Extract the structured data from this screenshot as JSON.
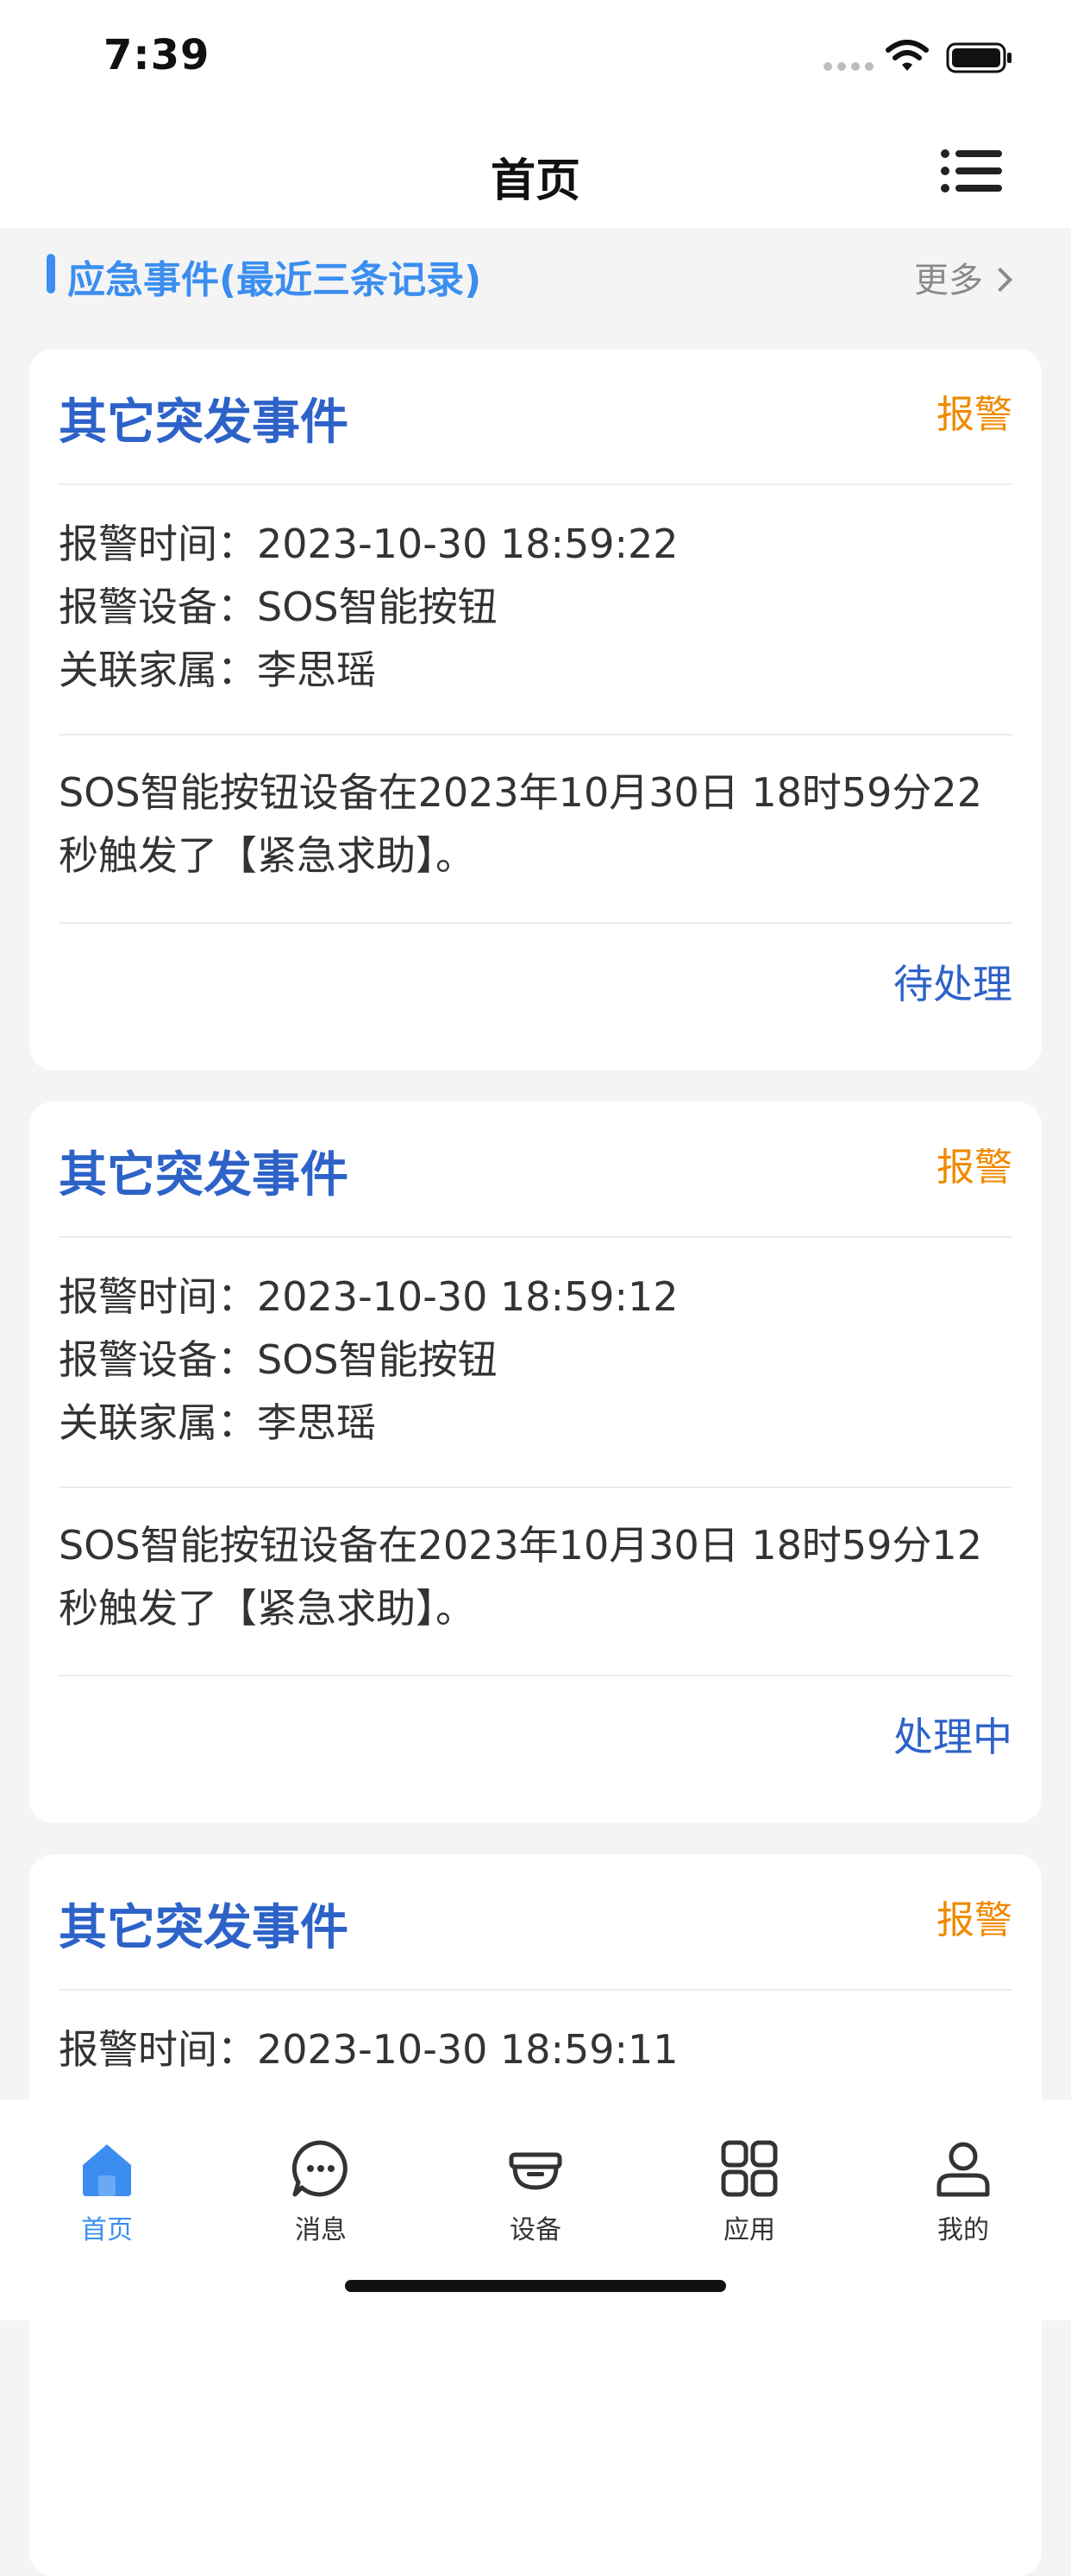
{
  "status_bar": {
    "time": "7:39"
  },
  "nav": {
    "title": "首页"
  },
  "section": {
    "title": "应急事件(最近三条记录)",
    "more": "更多"
  },
  "cards": [
    {
      "title": "其它突发事件",
      "badge": "报警",
      "alarm_time_label": "报警时间：",
      "alarm_time": "2023-10-30 18:59:22",
      "device_label": "报警设备：",
      "device": "SOS智能按钮",
      "family_label": "关联家属：",
      "family": "李思瑶",
      "desc_line1": "SOS智能按钮设备在2023年10月30日 18时59分22",
      "desc_line2": "秒触发了【紧急求助】。",
      "status": "待处理"
    },
    {
      "title": "其它突发事件",
      "badge": "报警",
      "alarm_time_label": "报警时间：",
      "alarm_time": "2023-10-30 18:59:12",
      "device_label": "报警设备：",
      "device": "SOS智能按钮",
      "family_label": "关联家属：",
      "family": "李思瑶",
      "desc_line1": "SOS智能按钮设备在2023年10月30日 18时59分12",
      "desc_line2": "秒触发了【紧急求助】。",
      "status": "处理中"
    },
    {
      "title": "其它突发事件",
      "badge": "报警",
      "alarm_time_label": "报警时间：",
      "alarm_time": "2023-10-30 18:59:11"
    }
  ],
  "tabs": [
    {
      "label": "首页",
      "icon": "home-icon",
      "active": true
    },
    {
      "label": "消息",
      "icon": "message-icon",
      "active": false
    },
    {
      "label": "设备",
      "icon": "device-icon",
      "active": false
    },
    {
      "label": "应用",
      "icon": "apps-icon",
      "active": false
    },
    {
      "label": "我的",
      "icon": "profile-icon",
      "active": false
    }
  ],
  "colors": {
    "accent": "#3b8ef0",
    "title_blue": "#2d62c8",
    "alarm_orange": "#f08a00",
    "background": "#f4f4f5"
  }
}
